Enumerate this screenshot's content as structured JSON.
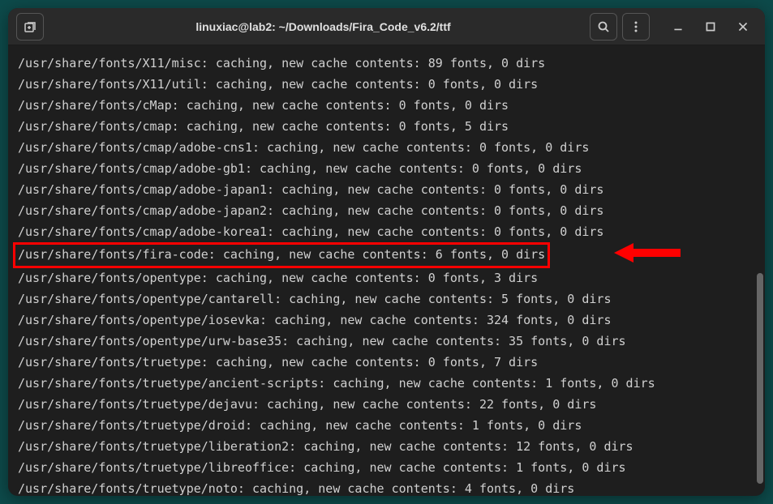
{
  "window": {
    "title": "linuxiac@lab2: ~/Downloads/Fira_Code_v6.2/ttf"
  },
  "highlighted_index": 9,
  "terminal_lines": [
    "/usr/share/fonts/X11/misc: caching, new cache contents: 89 fonts, 0 dirs",
    "/usr/share/fonts/X11/util: caching, new cache contents: 0 fonts, 0 dirs",
    "/usr/share/fonts/cMap: caching, new cache contents: 0 fonts, 0 dirs",
    "/usr/share/fonts/cmap: caching, new cache contents: 0 fonts, 5 dirs",
    "/usr/share/fonts/cmap/adobe-cns1: caching, new cache contents: 0 fonts, 0 dirs",
    "/usr/share/fonts/cmap/adobe-gb1: caching, new cache contents: 0 fonts, 0 dirs",
    "/usr/share/fonts/cmap/adobe-japan1: caching, new cache contents: 0 fonts, 0 dirs",
    "/usr/share/fonts/cmap/adobe-japan2: caching, new cache contents: 0 fonts, 0 dirs",
    "/usr/share/fonts/cmap/adobe-korea1: caching, new cache contents: 0 fonts, 0 dirs",
    "/usr/share/fonts/fira-code: caching, new cache contents: 6 fonts, 0 dirs",
    "/usr/share/fonts/opentype: caching, new cache contents: 0 fonts, 3 dirs",
    "/usr/share/fonts/opentype/cantarell: caching, new cache contents: 5 fonts, 0 dirs",
    "/usr/share/fonts/opentype/iosevka: caching, new cache contents: 324 fonts, 0 dirs",
    "/usr/share/fonts/opentype/urw-base35: caching, new cache contents: 35 fonts, 0 dirs",
    "/usr/share/fonts/truetype: caching, new cache contents: 0 fonts, 7 dirs",
    "/usr/share/fonts/truetype/ancient-scripts: caching, new cache contents: 1 fonts, 0 dirs",
    "/usr/share/fonts/truetype/dejavu: caching, new cache contents: 22 fonts, 0 dirs",
    "/usr/share/fonts/truetype/droid: caching, new cache contents: 1 fonts, 0 dirs",
    "/usr/share/fonts/truetype/liberation2: caching, new cache contents: 12 fonts, 0 dirs",
    "/usr/share/fonts/truetype/libreoffice: caching, new cache contents: 1 fonts, 0 dirs",
    "/usr/share/fonts/truetype/noto: caching, new cache contents: 4 fonts, 0 dirs"
  ]
}
